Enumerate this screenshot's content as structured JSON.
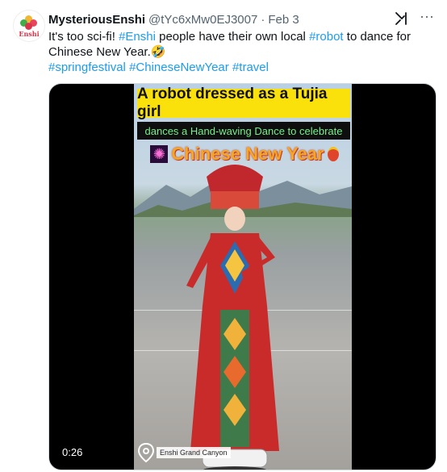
{
  "author": {
    "display_name": "MysteriousEnshi",
    "handle": "@tYc6xMw0EJ3007",
    "separator": "·",
    "date": "Feb 3",
    "avatar_text": "Enshi"
  },
  "tweet": {
    "text_before": "It's too sci-fi! ",
    "hashtag_enshi": "#Enshi",
    "text_middle": " people have their own local ",
    "hashtag_robot": "#robot",
    "text_after": " to dance for Chinese New Year.",
    "emoji": "🤣",
    "hashtags": [
      "#springfestival",
      "#ChineseNewYear",
      "#travel"
    ]
  },
  "media": {
    "title": "A robot dressed as a Tujia girl",
    "subtitle": "dances a Hand-waving Dance to celebrate",
    "headline": "Chinese New Year",
    "location": "Enshi Grand Canyon",
    "timestamp": "0:26"
  },
  "icons": {
    "more": "more-icon",
    "grok": "grok-icon"
  },
  "colors": {
    "link": "#1d9bf0",
    "title_bg": "#fbe10b",
    "subtitle_text": "#76f08a",
    "headline_text": "#f6a623"
  }
}
